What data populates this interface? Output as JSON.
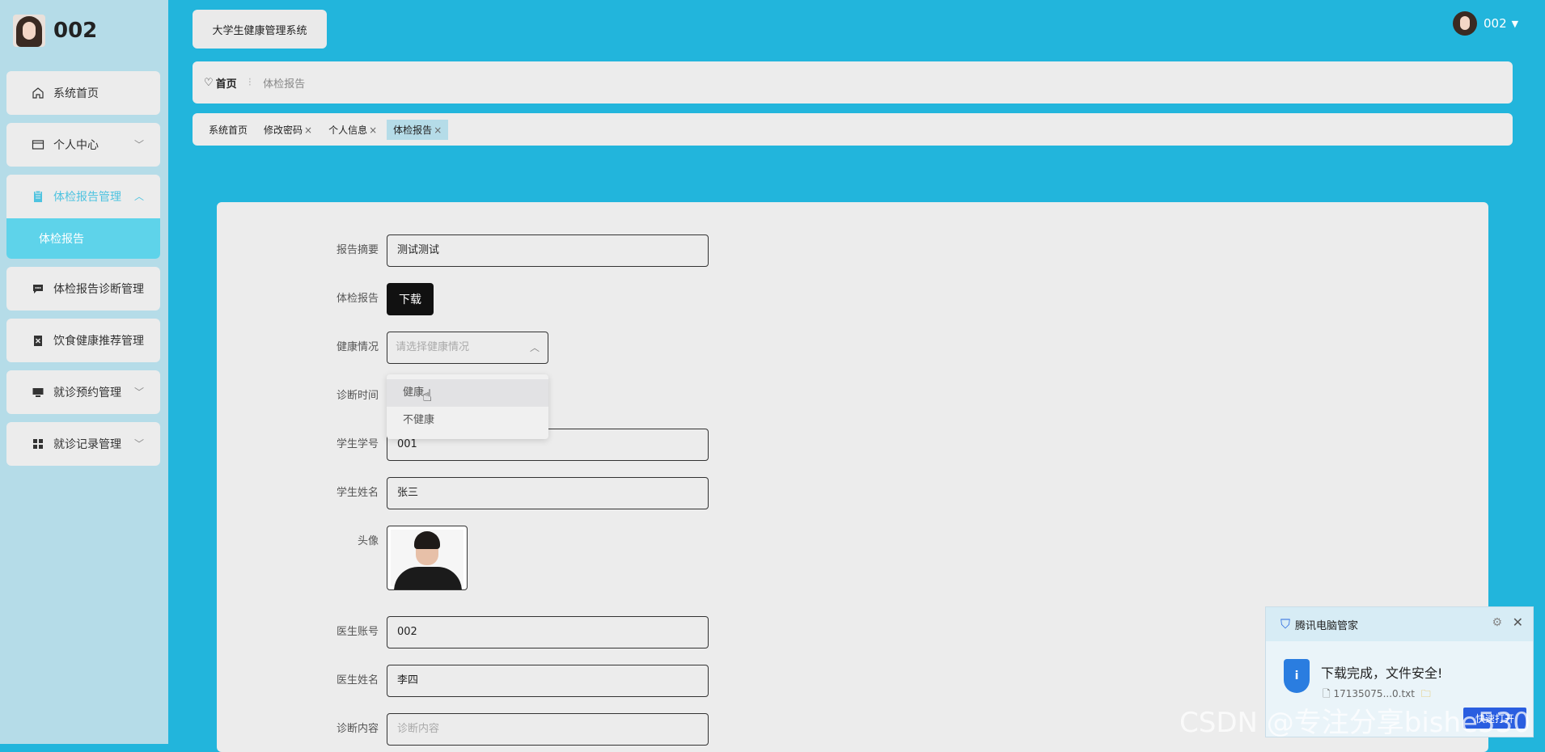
{
  "profile": {
    "name": "002"
  },
  "sidebar": {
    "items": [
      {
        "label": "系统首页",
        "icon": "home-icon"
      },
      {
        "label": "个人中心",
        "icon": "card-icon"
      },
      {
        "label": "体检报告管理",
        "icon": "clipboard-icon",
        "sub": "体检报告"
      },
      {
        "label": "体检报告诊断管理",
        "icon": "chat-icon"
      },
      {
        "label": "饮食健康推荐管理",
        "icon": "box-icon"
      },
      {
        "label": "就诊预约管理",
        "icon": "monitor-icon"
      },
      {
        "label": "就诊记录管理",
        "icon": "grid-icon"
      }
    ]
  },
  "header": {
    "app_title": "大学生健康管理系统",
    "user": "002"
  },
  "breadcrumb": {
    "home": "首页",
    "current": "体检报告"
  },
  "tabs": [
    {
      "label": "系统首页"
    },
    {
      "label": "修改密码",
      "close": "×"
    },
    {
      "label": "个人信息",
      "close": "×"
    },
    {
      "label": "体检报告",
      "close": "×"
    }
  ],
  "form": {
    "summary_label": "报告摘要",
    "summary_value": "测试测试",
    "report_label": "体检报告",
    "download_label": "下载",
    "health_label": "健康情况",
    "health_placeholder": "请选择健康情况",
    "health_options": [
      "健康",
      "不健康"
    ],
    "diagnosis_time_label": "诊断时间",
    "student_id_label": "学生学号",
    "student_id_value": "001",
    "student_name_label": "学生姓名",
    "student_name_value": "张三",
    "avatar_label": "头像",
    "doctor_account_label": "医生账号",
    "doctor_account_value": "002",
    "doctor_name_label": "医生姓名",
    "doctor_name_value": "李四",
    "diagnosis_content_label": "诊断内容",
    "diagnosis_content_placeholder": "诊断内容"
  },
  "notification": {
    "brand": "腾讯电脑管家",
    "title": "下载完成，文件安全!",
    "file": "17135075...0.txt",
    "button": "快速打开"
  },
  "watermark": "CSDN @专注分享bishe530",
  "colors": {
    "accent": "#22b5dc",
    "sidebar": "#b5dce8",
    "active_sub": "#5ed3ea"
  }
}
